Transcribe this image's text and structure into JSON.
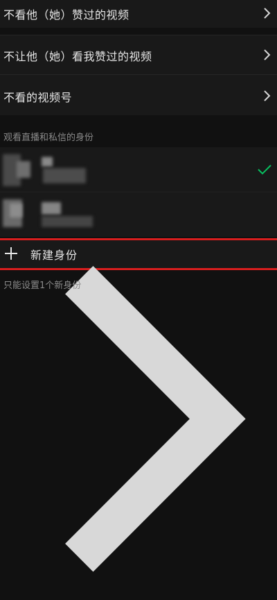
{
  "settings": {
    "items": [
      {
        "label": "不看他（她）赞过的视频",
        "icon": "chevron-right-icon"
      },
      {
        "label": "不让他（她）看我赞过的视频",
        "icon": "chevron-right-icon"
      },
      {
        "label": "不看的视频号",
        "icon": "chevron-right-icon"
      }
    ]
  },
  "identity_section": {
    "header": "观看直播和私信的身份",
    "identities": [
      {
        "selected": true,
        "selected_icon": "checkmark-icon",
        "obscured": true
      },
      {
        "selected": false,
        "obscured": true
      }
    ],
    "new_identity": {
      "label": "新建身份",
      "icon": "plus-icon",
      "chevron_icon": "chevron-right-icon"
    },
    "note": "只能设置1个新身份"
  },
  "colors": {
    "background": "#111111",
    "row_background": "#191919",
    "text_primary": "#e6e6e6",
    "text_secondary": "#8a8a8a",
    "check_green": "#07c160",
    "highlight_red": "#d81e1e"
  }
}
